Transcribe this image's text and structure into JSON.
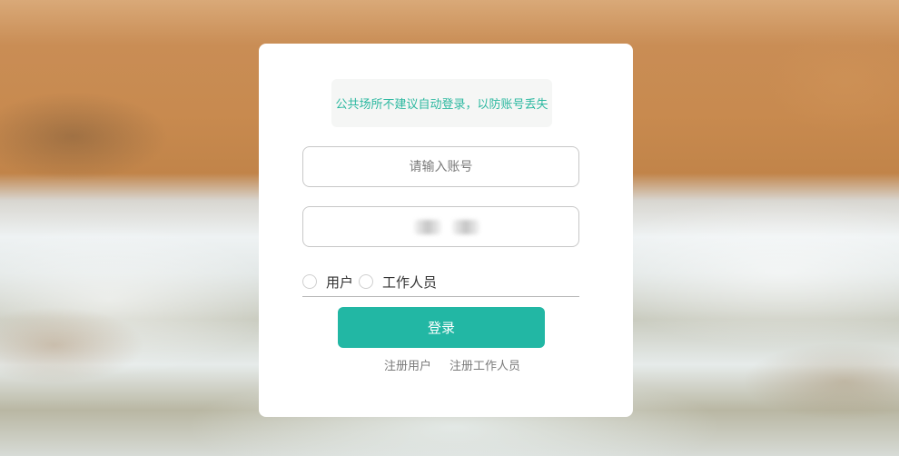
{
  "notice": {
    "text": "公共场所不建议自动登录，以防账号丢失"
  },
  "form": {
    "account_placeholder": "请输入账号",
    "account_value": "",
    "password_placeholder": "",
    "password_value": ""
  },
  "roles": {
    "options": [
      {
        "label": "用户",
        "selected": false
      },
      {
        "label": "工作人员",
        "selected": false
      }
    ]
  },
  "login_button": {
    "label": "登录"
  },
  "links": {
    "register_user": "注册用户",
    "register_staff": "注册工作人员"
  },
  "colors": {
    "accent": "#22b7a4",
    "notice_text": "#2cb8a0"
  }
}
